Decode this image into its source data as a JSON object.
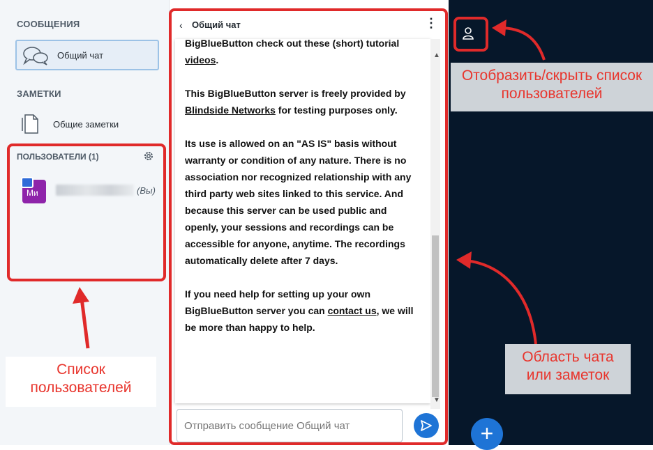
{
  "sidebar": {
    "messages_title": "СООБЩЕНИЯ",
    "chat_item_label": "Общий чат",
    "notes_title": "ЗАМЕТКИ",
    "notes_item_label": "Общие заметки",
    "users_title": "ПОЛЬЗОВАТЕЛИ (1)",
    "user": {
      "initials": "Ми",
      "you_label": "(Вы)"
    }
  },
  "chat": {
    "back_icon": "‹",
    "title": "Общий чат",
    "menu_icon": "⋮",
    "message": {
      "line0": "BigBlueButton check out these (short) tutorial",
      "videos_link": "videos",
      "videos_end": ".",
      "p2_start": "This BigBlueButton server is freely provided by ",
      "p2_link": "Blindside Networks",
      "p2_end": " for testing purposes only.",
      "p3": "Its use is allowed on an \"AS IS\" basis without warranty or condition of any nature. There is no association nor recognized relationship with any third party web sites linked to this service. And because this server can be used public and openly, your sessions and recordings can be accessible for anyone, anytime. The recordings automatically delete after 7 days.",
      "p4_start": "If you need help for setting up your own BigBlueButton server you can ",
      "p4_link": "contact us",
      "p4_end": ", we will be more than happy to help."
    },
    "input_placeholder": "Отправить сообщение Общий чат"
  },
  "annotations": {
    "toggle_label": "Отобразить/скрыть список пользователей",
    "chat_area_label": "Область чата или заметок",
    "users_list_label": "Список пользователей"
  },
  "colors": {
    "annotation_red": "#e02a2a",
    "stage_background": "#06172a",
    "accent_blue": "#1e74d6",
    "avatar_purple": "#8e24aa"
  },
  "icons": [
    "chat-bubbles-icon",
    "notes-document-icon",
    "gear-icon",
    "presenter-icon",
    "user-icon",
    "send-icon",
    "plus-icon"
  ]
}
